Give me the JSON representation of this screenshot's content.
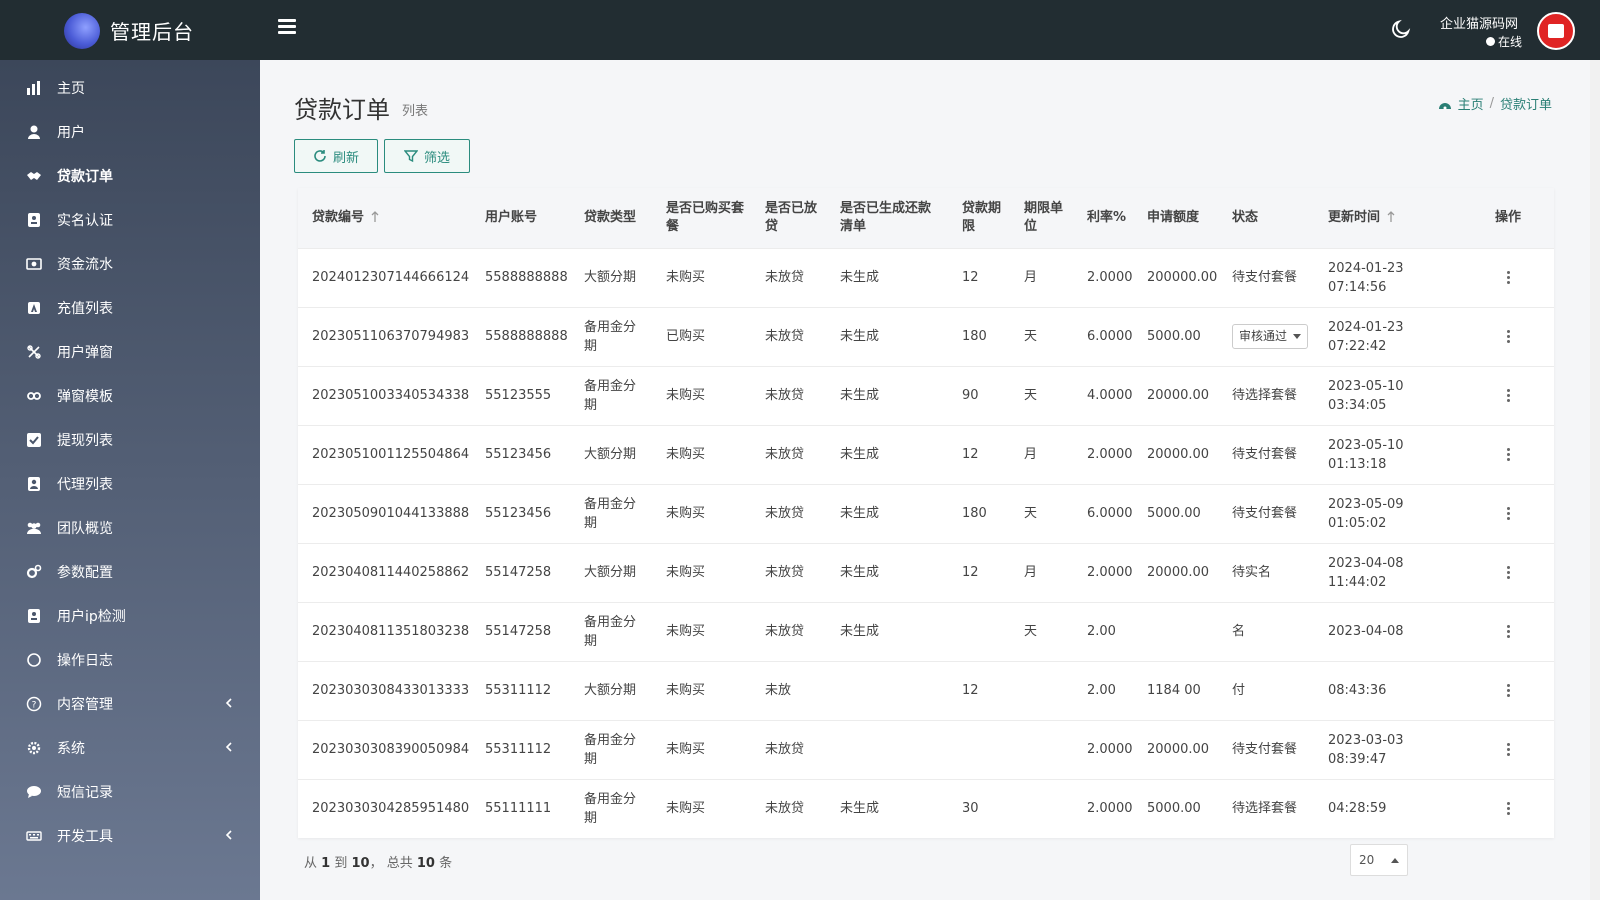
{
  "app": {
    "title": "管理后台",
    "user_name": "企业猫源码网",
    "user_status": "在线",
    "accent": "#2b8c7e",
    "topbar_color": "#222d32"
  },
  "sidebar": {
    "items": [
      {
        "label": "主页",
        "icon": "bar-chart-icon"
      },
      {
        "label": "用户",
        "icon": "user-icon"
      },
      {
        "label": "贷款订单",
        "icon": "handshake-icon",
        "active": true
      },
      {
        "label": "实名认证",
        "icon": "id-card-icon"
      },
      {
        "label": "资金流水",
        "icon": "money-icon"
      },
      {
        "label": "充值列表",
        "icon": "recharge-icon"
      },
      {
        "label": "用户弹窗",
        "icon": "popup-icon"
      },
      {
        "label": "弹窗模板",
        "icon": "link-icon"
      },
      {
        "label": "提现列表",
        "icon": "check-square-icon"
      },
      {
        "label": "代理列表",
        "icon": "agent-icon"
      },
      {
        "label": "团队概览",
        "icon": "team-icon"
      },
      {
        "label": "参数配置",
        "icon": "cogs-icon"
      },
      {
        "label": "用户ip检测",
        "icon": "ip-icon"
      },
      {
        "label": "操作日志",
        "icon": "circle-icon"
      },
      {
        "label": "内容管理",
        "icon": "question-circle-icon",
        "expandable": true
      },
      {
        "label": "系统",
        "icon": "gear-icon",
        "expandable": true
      },
      {
        "label": "短信记录",
        "icon": "comment-icon"
      },
      {
        "label": "开发工具",
        "icon": "keyboard-icon",
        "expandable": true
      }
    ]
  },
  "page": {
    "title": "贷款订单",
    "subtitle": "列表",
    "breadcrumb_home": "主页",
    "breadcrumb_current": "贷款订单",
    "refresh_label": "刷新",
    "filter_label": "筛选"
  },
  "table": {
    "columns": [
      "贷款编号",
      "用户账号",
      "贷款类型",
      "是否已购买套餐",
      "是否已放贷",
      "是否已生成还款清单",
      "贷款期限",
      "期限单位",
      "利率%",
      "申请额度",
      "状态",
      "更新时间",
      "操作"
    ],
    "rows": [
      {
        "id": "2024012307144666124",
        "account": "5588888888",
        "type": "大额分期",
        "bought": "未购买",
        "lent": "未放贷",
        "generated": "未生成",
        "term": "12",
        "unit": "月",
        "rate": "2.0000",
        "amount": "200000.00",
        "status": "待支付套餐",
        "date": "2024-01-23",
        "time": "07:14:56"
      },
      {
        "id": "2023051106370794983",
        "account": "5588888888",
        "type": "备用金分期",
        "bought": "已购买",
        "lent": "未放贷",
        "generated": "未生成",
        "term": "180",
        "unit": "天",
        "rate": "6.0000",
        "amount": "5000.00",
        "status": "审核通过",
        "status_select": true,
        "date": "2024-01-23",
        "time": "07:22:42"
      },
      {
        "id": "2023051003340534338",
        "account": "55123555",
        "type": "备用金分期",
        "bought": "未购买",
        "lent": "未放贷",
        "generated": "未生成",
        "term": "90",
        "unit": "天",
        "rate": "4.0000",
        "amount": "20000.00",
        "status": "待选择套餐",
        "date": "2023-05-10",
        "time": "03:34:05"
      },
      {
        "id": "2023051001125504864",
        "account": "55123456",
        "type": "大额分期",
        "bought": "未购买",
        "lent": "未放贷",
        "generated": "未生成",
        "term": "12",
        "unit": "月",
        "rate": "2.0000",
        "amount": "20000.00",
        "status": "待支付套餐",
        "date": "2023-05-10",
        "time": "01:13:18"
      },
      {
        "id": "2023050901044133888",
        "account": "55123456",
        "type": "备用金分期",
        "bought": "未购买",
        "lent": "未放贷",
        "generated": "未生成",
        "term": "180",
        "unit": "天",
        "rate": "6.0000",
        "amount": "5000.00",
        "status": "待支付套餐",
        "date": "2023-05-09",
        "time": "01:05:02"
      },
      {
        "id": "2023040811440258862",
        "account": "55147258",
        "type": "大额分期",
        "bought": "未购买",
        "lent": "未放贷",
        "generated": "未生成",
        "term": "12",
        "unit": "月",
        "rate": "2.0000",
        "amount": "20000.00",
        "status": "待实名",
        "date": "2023-04-08",
        "time": "11:44:02"
      },
      {
        "id": "2023040811351803238",
        "account": "55147258",
        "type": "备用金分期",
        "bought": "未购买",
        "lent": "未放贷",
        "generated": "未生成",
        "term": "",
        "unit": "天",
        "rate": "2.00",
        "amount": "",
        "status": "名",
        "date": "2023-04-08",
        "time": ""
      },
      {
        "id": "2023030308433013333",
        "account": "55311112",
        "type": "大额分期",
        "bought": "未购买",
        "lent": "未放",
        "generated": "",
        "term": "12",
        "unit": "",
        "rate": "2.00",
        "amount": "1184 00",
        "status": "付",
        "date": "",
        "time": "08:43:36"
      },
      {
        "id": "2023030308390050984",
        "account": "55311112",
        "type": "备用金分期",
        "bought": "未购买",
        "lent": "未放贷",
        "generated": "",
        "term": "",
        "unit": "",
        "rate": "2.0000",
        "amount": "20000.00",
        "status": "待支付套餐",
        "date": "2023-03-03",
        "time": "08:39:47"
      },
      {
        "id": "2023030304285951480",
        "account": "55111111",
        "type": "备用金分期",
        "bought": "未购买",
        "lent": "未放贷",
        "generated": "未生成",
        "term": "30",
        "unit": "",
        "rate": "2.0000",
        "amount": "5000.00",
        "status": "待选择套餐",
        "date": "",
        "time": "04:28:59"
      }
    ]
  },
  "footer": {
    "from_label": "从",
    "start": "1",
    "to_label": "到",
    "end": "10",
    "total_label": "， 总共",
    "total": "10",
    "unit_label": "条",
    "page_size": "20"
  }
}
